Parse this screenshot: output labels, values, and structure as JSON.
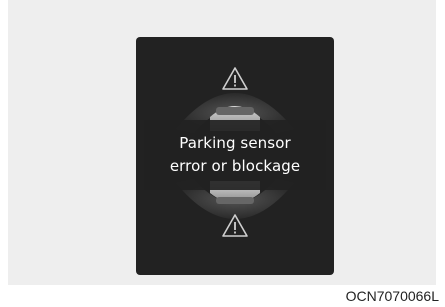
{
  "display": {
    "message_line1": "Parking sensor",
    "message_line2": "error or blockage",
    "warning_icon_top": "warning-triangle-icon",
    "warning_icon_bottom": "warning-triangle-icon",
    "vehicle_icon": "car-top-view-icon"
  },
  "caption": "OCN7070066L",
  "colors": {
    "screen_background": "#222222",
    "sensor_zone": "#555555",
    "page_background": "#eeeeee"
  }
}
